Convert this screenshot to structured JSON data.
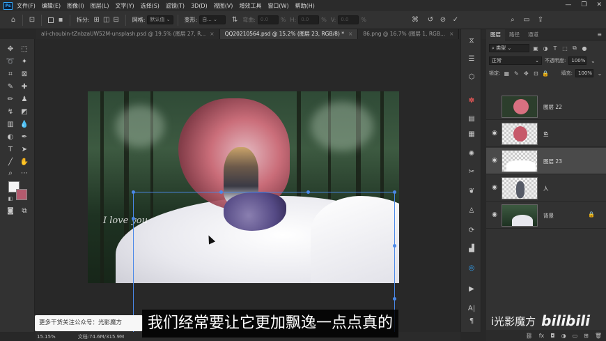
{
  "app": {
    "logo": "Ps"
  },
  "menu": [
    "文件(F)",
    "编辑(E)",
    "图像(I)",
    "图层(L)",
    "文字(Y)",
    "选择(S)",
    "滤镜(T)",
    "3D(D)",
    "视图(V)",
    "增效工具",
    "窗口(W)",
    "帮助(H)"
  ],
  "window_controls": {
    "minimize": "—",
    "restore": "❐",
    "close": "✕"
  },
  "options": {
    "split_label": "拆分:",
    "grid_label": "网格:",
    "grid_value": "默认值",
    "warp_label": "变形:",
    "warp_value": "自...",
    "bend_label": "弯曲:",
    "bend_value": "0.0",
    "h_label": "H:",
    "h_value": "0.0",
    "v_label": "V:",
    "v_value": "0.0",
    "percent": "%"
  },
  "tabs": [
    {
      "label": "ali-choubin-tZnbzaUW52M-unsplash.psd @ 19.5% (图层 27, R...",
      "active": false
    },
    {
      "label": "QQ20210564.psd @ 15.2% (图层 23, RGB/8) *",
      "active": true
    },
    {
      "label": "86.png @ 16.7% (图层 1, RGB...",
      "active": false
    }
  ],
  "canvas": {
    "logo_text": "I love you"
  },
  "panel": {
    "tabs": [
      "图层",
      "路径",
      "通道"
    ],
    "search_placeholder": "类型",
    "blend_mode": "正常",
    "opacity_label": "不透明度:",
    "opacity_value": "100%",
    "lock_label": "锁定:",
    "fill_label": "填充:",
    "fill_value": "100%",
    "layers": [
      {
        "name": "图层 22",
        "visible": false,
        "selected": false
      },
      {
        "name": "鱼",
        "visible": true,
        "selected": false
      },
      {
        "name": "图层 23",
        "visible": true,
        "selected": true
      },
      {
        "name": "人",
        "visible": true,
        "selected": false
      },
      {
        "name": "背景",
        "visible": true,
        "selected": false,
        "locked": true
      }
    ],
    "bottom_icons": [
      "link-icon",
      "fx-icon",
      "mask-icon",
      "adjustment-icon",
      "group-icon",
      "new-layer-icon",
      "trash-icon"
    ]
  },
  "status": {
    "zoom": "15.15%",
    "doc_size": "文档:74.6M/315.9M"
  },
  "overlay": {
    "promo": "更多干货关注公众号：光影魔方",
    "subtitle": "我们经常要让它更加飘逸一点点真的",
    "watermark_text": "i光影魔方",
    "watermark_logo": "bilibili"
  },
  "colors": {
    "foreground": "#f5f5f5",
    "background": "#b35a6e",
    "accent": "#4a88e8"
  }
}
